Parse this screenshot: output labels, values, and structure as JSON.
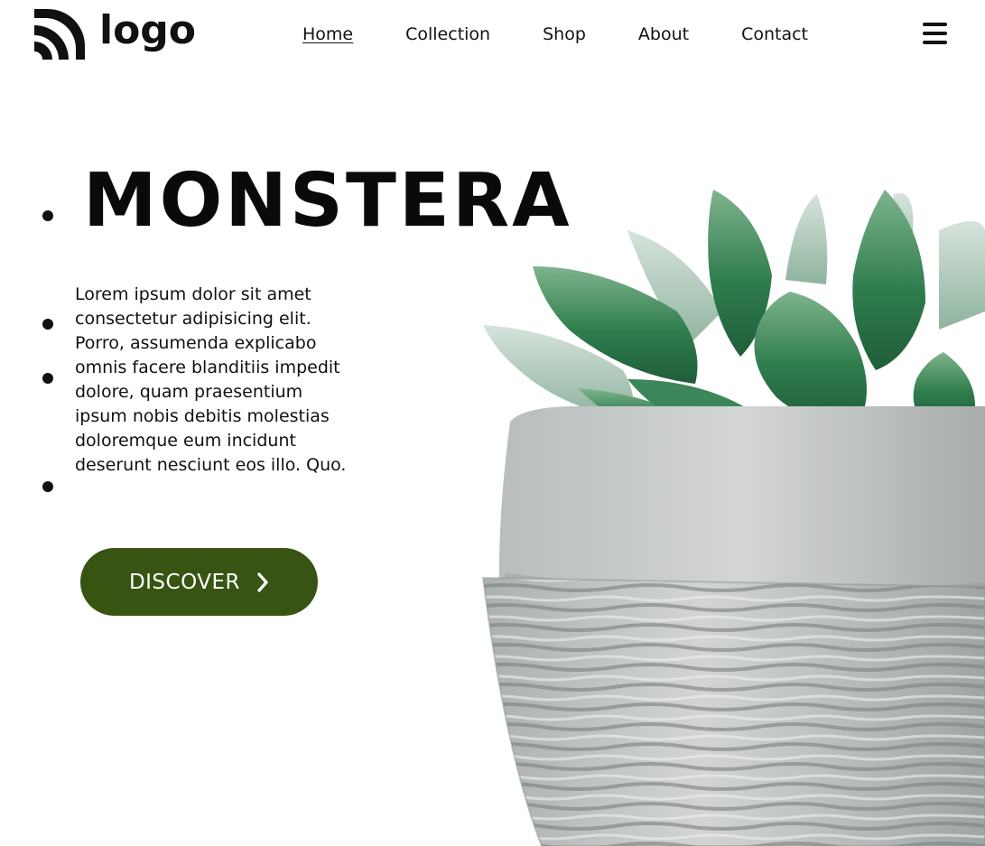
{
  "header": {
    "logo_text": "logo",
    "nav": [
      {
        "label": "Home",
        "active": true
      },
      {
        "label": "Collection",
        "active": false
      },
      {
        "label": "Shop",
        "active": false
      },
      {
        "label": "About",
        "active": false
      },
      {
        "label": "Contact",
        "active": false
      }
    ],
    "menu_icon": "hamburger-icon"
  },
  "hero": {
    "title": "MONSTERA",
    "description": "Lorem ipsum dolor sit amet consectetur adipisicing elit. Porro, assumenda explicabo omnis facere blanditiis impedit dolore, quam praesentium ipsum nobis debitis molestias doloremque eum incidunt deserunt nesciunt eos illo. Quo.",
    "cta_label": "DISCOVER",
    "cta_icon": "chevron-right-icon"
  },
  "colors": {
    "accent": "#375413",
    "text": "#111111",
    "background": "#ffffff"
  },
  "icons": {
    "logo": "logo-arcs-icon",
    "menu": "hamburger-icon",
    "cta": "chevron-right-icon"
  }
}
